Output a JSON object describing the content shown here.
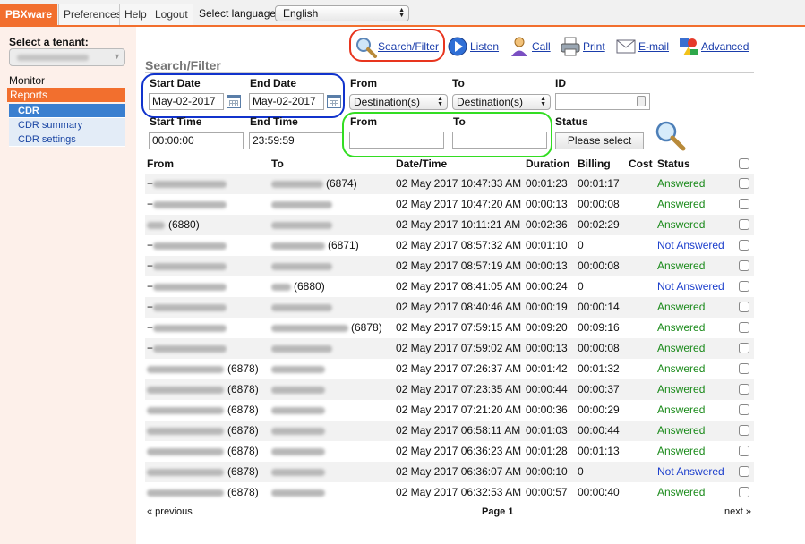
{
  "topbar": {
    "tabs": [
      "PBXware",
      "Preferences",
      "Help",
      "Logout"
    ],
    "language_label": "Select language:",
    "language_value": "English"
  },
  "sidebar": {
    "tenant_label": "Select a tenant:",
    "monitor": "Monitor",
    "reports": "Reports",
    "subitems": [
      "CDR",
      "CDR summary",
      "CDR settings"
    ]
  },
  "toolbar": {
    "search_filter": "Search/Filter",
    "listen": "Listen",
    "call": "Call",
    "print": "Print",
    "email": "E-mail",
    "advanced": "Advanced"
  },
  "filter": {
    "title": "Search/Filter",
    "start_date_label": "Start Date",
    "start_date": "May-02-2017",
    "end_date_label": "End Date",
    "end_date": "May-02-2017",
    "from_label": "From",
    "from_value": "Destination(s)",
    "to_label": "To",
    "to_value": "Destination(s)",
    "id_label": "ID",
    "start_time_label": "Start Time",
    "start_time": "00:00:00",
    "end_time_label": "End Time",
    "end_time": "23:59:59",
    "from2_label": "From",
    "to2_label": "To",
    "status_label": "Status",
    "status_button": "Please select"
  },
  "table": {
    "headers": [
      "From",
      "To",
      "Date/Time",
      "Duration",
      "Billing",
      "Cost",
      "Status"
    ],
    "rows": [
      {
        "from": "+",
        "to": "(6874)",
        "datetime": "02 May 2017 10:47:33 AM",
        "duration": "00:01:23",
        "billing": "00:01:17",
        "status": "Answered"
      },
      {
        "from": "+",
        "to": "",
        "datetime": "02 May 2017 10:47:20 AM",
        "duration": "00:00:13",
        "billing": "00:00:08",
        "status": "Answered"
      },
      {
        "from": "(6880)",
        "to": "",
        "datetime": "02 May 2017 10:11:21 AM",
        "duration": "00:02:36",
        "billing": "00:02:29",
        "status": "Answered"
      },
      {
        "from": "+",
        "to": "(6871)",
        "datetime": "02 May 2017 08:57:32 AM",
        "duration": "00:01:10",
        "billing": "0",
        "status": "Not Answered"
      },
      {
        "from": "+",
        "to": "",
        "datetime": "02 May 2017 08:57:19 AM",
        "duration": "00:00:13",
        "billing": "00:00:08",
        "status": "Answered"
      },
      {
        "from": "+",
        "to": "(6880)",
        "datetime": "02 May 2017 08:41:05 AM",
        "duration": "00:00:24",
        "billing": "0",
        "status": "Not Answered"
      },
      {
        "from": "+",
        "to": "",
        "datetime": "02 May 2017 08:40:46 AM",
        "duration": "00:00:19",
        "billing": "00:00:14",
        "status": "Answered"
      },
      {
        "from": "+",
        "to": "(6878)",
        "datetime": "02 May 2017 07:59:15 AM",
        "duration": "00:09:20",
        "billing": "00:09:16",
        "status": "Answered"
      },
      {
        "from": "+",
        "to": "",
        "datetime": "02 May 2017 07:59:02 AM",
        "duration": "00:00:13",
        "billing": "00:00:08",
        "status": "Answered"
      },
      {
        "from": "(6878)",
        "to": "",
        "datetime": "02 May 2017 07:26:37 AM",
        "duration": "00:01:42",
        "billing": "00:01:32",
        "status": "Answered"
      },
      {
        "from": "(6878)",
        "to": "",
        "datetime": "02 May 2017 07:23:35 AM",
        "duration": "00:00:44",
        "billing": "00:00:37",
        "status": "Answered"
      },
      {
        "from": "(6878)",
        "to": "",
        "datetime": "02 May 2017 07:21:20 AM",
        "duration": "00:00:36",
        "billing": "00:00:29",
        "status": "Answered"
      },
      {
        "from": "(6878)",
        "to": "",
        "datetime": "02 May 2017 06:58:11 AM",
        "duration": "00:01:03",
        "billing": "00:00:44",
        "status": "Answered"
      },
      {
        "from": "(6878)",
        "to": "",
        "datetime": "02 May 2017 06:36:23 AM",
        "duration": "00:01:28",
        "billing": "00:01:13",
        "status": "Answered"
      },
      {
        "from": "(6878)",
        "to": "",
        "datetime": "02 May 2017 06:36:07 AM",
        "duration": "00:00:10",
        "billing": "0",
        "status": "Not Answered"
      },
      {
        "from": "(6878)",
        "to": "",
        "datetime": "02 May 2017 06:32:53 AM",
        "duration": "00:00:57",
        "billing": "00:00:40",
        "status": "Answered"
      }
    ]
  },
  "pager": {
    "previous": "« previous",
    "page": "Page 1",
    "next": "next »"
  },
  "colors": {
    "accent": "#f26f2e",
    "answered": "#1a8a1a",
    "not_answered": "#1a3dcc",
    "ring_red": "#e8351e",
    "ring_blue": "#1133cc",
    "ring_green": "#33dd22"
  }
}
